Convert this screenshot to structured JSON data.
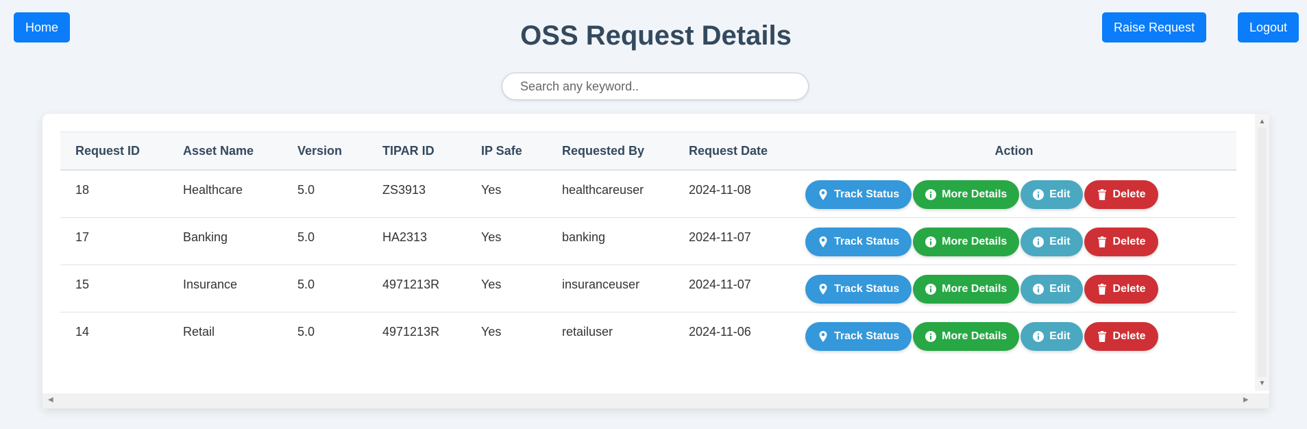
{
  "header": {
    "home_label": "Home",
    "title": "OSS Request Details",
    "raise_label": "Raise Request",
    "logout_label": "Logout"
  },
  "search": {
    "placeholder": "Search any keyword..",
    "value": ""
  },
  "table": {
    "columns": [
      "Request ID",
      "Asset Name",
      "Version",
      "TIPAR ID",
      "IP Safe",
      "Requested By",
      "Request Date",
      "Action"
    ],
    "rows": [
      [
        "18",
        "Healthcare",
        "5.0",
        "ZS3913",
        "Yes",
        "healthcareuser",
        "2024-11-08"
      ],
      [
        "17",
        "Banking",
        "5.0",
        "HA2313",
        "Yes",
        "banking",
        "2024-11-07"
      ],
      [
        "15",
        "Insurance",
        "5.0",
        "4971213R",
        "Yes",
        "insuranceuser",
        "2024-11-07"
      ],
      [
        "14",
        "Retail",
        "5.0",
        "4971213R",
        "Yes",
        "retailuser",
        "2024-11-06"
      ]
    ],
    "actions": {
      "track_label": "Track Status",
      "more_label": "More Details",
      "edit_label": "Edit",
      "delete_label": "Delete",
      "track_icon": "map-marker-icon",
      "more_icon": "info-circle-icon",
      "edit_icon": "info-circle-icon",
      "delete_icon": "trash-icon"
    }
  },
  "colors": {
    "primary": "#0b7dfa",
    "track": "#3498db",
    "more": "#28a745",
    "edit": "#4aa8c0",
    "delete": "#cf3035",
    "title": "#34495e"
  }
}
